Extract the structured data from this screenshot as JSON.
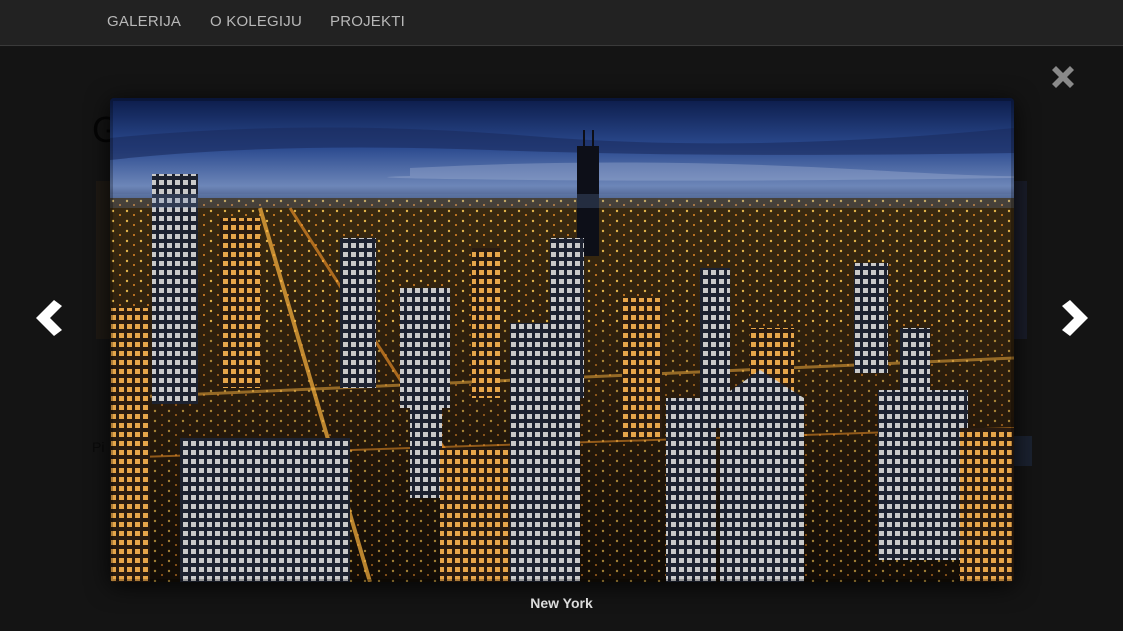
{
  "navbar": {
    "items": [
      {
        "label": "GALERIJA"
      },
      {
        "label": "O KOLEGIJU"
      },
      {
        "label": "PROJEKTI"
      }
    ]
  },
  "lightbox": {
    "caption": "New York",
    "image_subject": "night city skyline aerial photo",
    "icons": {
      "close": "close-icon",
      "previous": "chevron-left-icon",
      "next": "chevron-right-icon"
    }
  },
  "colors": {
    "navbar_bg": "#222222",
    "nav_text": "#b8b8b8",
    "overlay_bg": "#151515",
    "caption_text": "#dcdcdc",
    "control_white": "#ffffff",
    "close_grey": "#8a8a8a"
  }
}
